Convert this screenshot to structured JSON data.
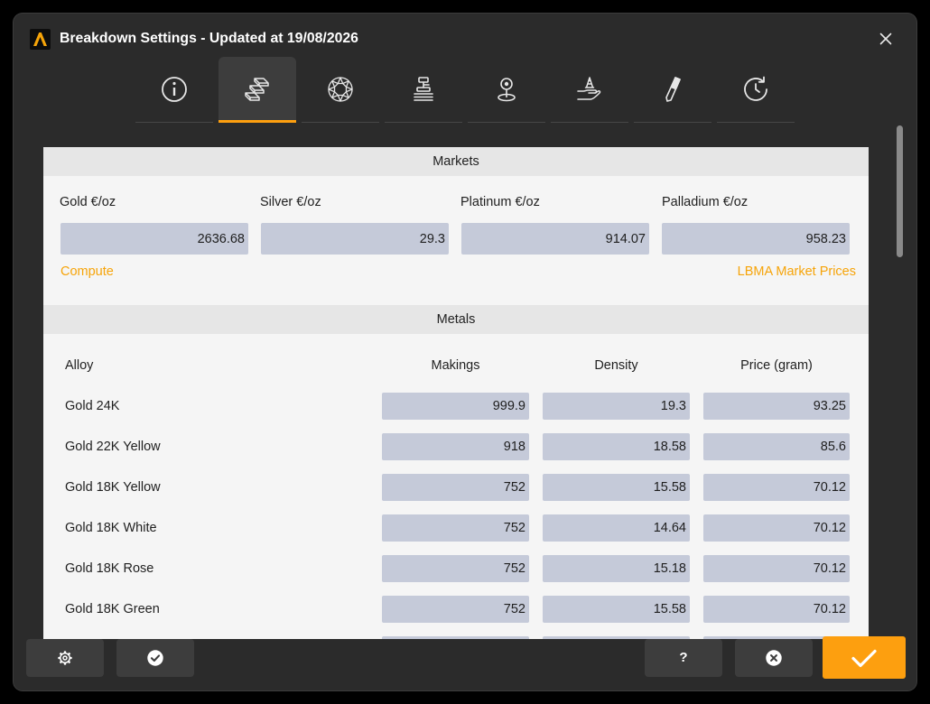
{
  "window": {
    "title": "Breakdown Settings - Updated at 19/08/2026",
    "app_icon": "app-logo-icon",
    "close_icon": "close-icon"
  },
  "tabs": [
    {
      "icon": "info-icon",
      "selected": false
    },
    {
      "icon": "gold-bars-icon",
      "selected": true
    },
    {
      "icon": "gem-icon",
      "selected": false
    },
    {
      "icon": "stamp-press-icon",
      "selected": false
    },
    {
      "icon": "location-pin-icon",
      "selected": false
    },
    {
      "icon": "hand-setting-icon",
      "selected": false
    },
    {
      "icon": "engraving-tool-icon",
      "selected": false
    },
    {
      "icon": "history-icon",
      "selected": false
    }
  ],
  "markets": {
    "title": "Markets",
    "fields": [
      {
        "label": "Gold €/oz",
        "value": "2636.68"
      },
      {
        "label": "Silver €/oz",
        "value": "29.3"
      },
      {
        "label": "Platinum €/oz",
        "value": "914.07"
      },
      {
        "label": "Palladium €/oz",
        "value": "958.23"
      }
    ],
    "compute_link": "Compute",
    "lbma_link": "LBMA Market Prices"
  },
  "metals": {
    "title": "Metals",
    "columns": [
      "Alloy",
      "Makings",
      "Density",
      "Price (gram)"
    ],
    "rows": [
      {
        "alloy": "Gold 24K",
        "makings": "999.9",
        "density": "19.3",
        "price": "93.25"
      },
      {
        "alloy": "Gold 22K Yellow",
        "makings": "918",
        "density": "18.58",
        "price": "85.6"
      },
      {
        "alloy": "Gold 18K Yellow",
        "makings": "752",
        "density": "15.58",
        "price": "70.12"
      },
      {
        "alloy": "Gold 18K White",
        "makings": "752",
        "density": "14.64",
        "price": "70.12"
      },
      {
        "alloy": "Gold 18K Rose",
        "makings": "752",
        "density": "15.18",
        "price": "70.12"
      },
      {
        "alloy": "Gold 18K Green",
        "makings": "752",
        "density": "15.58",
        "price": "70.12"
      }
    ]
  },
  "footer": {
    "settings_icon": "gear-icon",
    "apply_icon": "check-circle-icon",
    "help_label": "?",
    "cancel_icon": "close-circle-icon",
    "confirm_icon": "checkmark-icon"
  },
  "colors": {
    "accent": "#fd9f0f",
    "link": "#f6a409",
    "window_bg": "#2b2b2b",
    "panel_bg": "#f5f5f5",
    "section_header_bg": "#e6e6e6",
    "input_bg": "#c5cad9",
    "button_bg": "#3d3d3d",
    "tab_selected_bg": "#3d3d3d"
  }
}
